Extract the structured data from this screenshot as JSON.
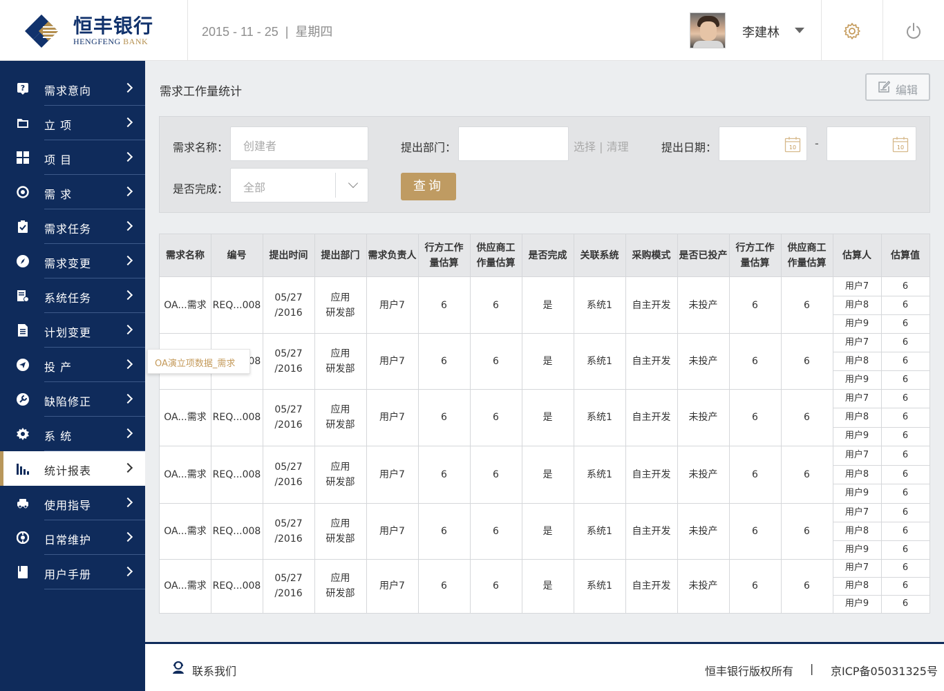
{
  "header": {
    "logo_cn": "恒丰银行",
    "logo_en_a": "HENGFENG",
    "logo_en_b": "BANK",
    "date_parts": [
      "2015 - 11 - 25",
      "|",
      "星期四"
    ],
    "user_name": "李建林"
  },
  "sidebar": {
    "items": [
      {
        "label": "需求意向",
        "icon": "question-icon"
      },
      {
        "label": "立  项",
        "icon": "folder-icon"
      },
      {
        "label": "项  目",
        "icon": "grid-icon"
      },
      {
        "label": "需  求",
        "icon": "target-icon"
      },
      {
        "label": "需求任务",
        "icon": "clipboard-check-icon"
      },
      {
        "label": "需求变更",
        "icon": "compass-icon"
      },
      {
        "label": "系统任务",
        "icon": "doc-edit-icon"
      },
      {
        "label": "计划变更",
        "icon": "document-icon"
      },
      {
        "label": "投  产",
        "icon": "send-icon"
      },
      {
        "label": "缺陷修正",
        "icon": "wrench-icon"
      },
      {
        "label": "系  统",
        "icon": "gear-icon"
      },
      {
        "label": "统计报表",
        "icon": "bar-chart-icon",
        "active": true
      },
      {
        "label": "使用指导",
        "icon": "car-icon"
      },
      {
        "label": "日常维护",
        "icon": "maintenance-icon"
      },
      {
        "label": "用户手册",
        "icon": "book-icon"
      }
    ]
  },
  "main": {
    "title": "需求工作量统计",
    "edit_label": "编辑"
  },
  "filter": {
    "name_label": "需求名称：",
    "name_placeholder": "创建者",
    "dept_label": "提出部门：",
    "dept_value": "",
    "dept_links": "选择 | 清理",
    "date_label": "提出日期：",
    "date_sep": "-",
    "done_label": "是否完成：",
    "done_value": "全部",
    "query_label": "查询",
    "calendar_day": "10"
  },
  "table": {
    "headers": [
      "需求名称",
      "编号",
      "提出时间",
      "提出部门",
      "需求负责人",
      "行方工作量估算",
      "供应商工作量估算",
      "是否完成",
      "关联系统",
      "采购模式",
      "是否已投产",
      "行方工作量估算",
      "供应商工作量估算",
      "估算人",
      "估算值"
    ],
    "header_lines": [
      [
        "需求名称"
      ],
      [
        "编号"
      ],
      [
        "提出时间"
      ],
      [
        "提出部门"
      ],
      [
        "需求负责人"
      ],
      [
        "行方工作",
        "量估算"
      ],
      [
        "供应商工",
        "作量估算"
      ],
      [
        "是否完成"
      ],
      [
        "关联系统"
      ],
      [
        "采购模式"
      ],
      [
        "是否已投产"
      ],
      [
        "行方工作",
        "量估算"
      ],
      [
        "供应商工",
        "作量估算"
      ],
      [
        "估算人"
      ],
      [
        "估算值"
      ]
    ],
    "rows": [
      {
        "name": "OA...需求",
        "code": "REQ...008",
        "date1": "05/27",
        "date2": "/2016",
        "dept1": "应用",
        "dept2": "研发部",
        "owner": "用户7",
        "bank_est": "6",
        "vendor_est": "6",
        "done": "是",
        "system": "系统1",
        "mode": "自主开发",
        "prod": "未投产",
        "bank_est2": "6",
        "vendor_est2": "6",
        "estimators": [
          {
            "user": "用户7",
            "value": "6"
          },
          {
            "user": "用户8",
            "value": "6"
          },
          {
            "user": "用户9",
            "value": "6"
          }
        ]
      },
      {
        "name": "OA...需求",
        "code": "REQ...008",
        "date1": "05/27",
        "date2": "/2016",
        "dept1": "应用",
        "dept2": "研发部",
        "owner": "用户7",
        "bank_est": "6",
        "vendor_est": "6",
        "done": "是",
        "system": "系统1",
        "mode": "自主开发",
        "prod": "未投产",
        "bank_est2": "6",
        "vendor_est2": "6",
        "estimators": [
          {
            "user": "用户7",
            "value": "6"
          },
          {
            "user": "用户8",
            "value": "6"
          },
          {
            "user": "用户9",
            "value": "6"
          }
        ]
      },
      {
        "name": "OA...需求",
        "code": "REQ...008",
        "date1": "05/27",
        "date2": "/2016",
        "dept1": "应用",
        "dept2": "研发部",
        "owner": "用户7",
        "bank_est": "6",
        "vendor_est": "6",
        "done": "是",
        "system": "系统1",
        "mode": "自主开发",
        "prod": "未投产",
        "bank_est2": "6",
        "vendor_est2": "6",
        "estimators": [
          {
            "user": "用户7",
            "value": "6"
          },
          {
            "user": "用户8",
            "value": "6"
          },
          {
            "user": "用户9",
            "value": "6"
          }
        ]
      },
      {
        "name": "OA...需求",
        "code": "REQ...008",
        "date1": "05/27",
        "date2": "/2016",
        "dept1": "应用",
        "dept2": "研发部",
        "owner": "用户7",
        "bank_est": "6",
        "vendor_est": "6",
        "done": "是",
        "system": "系统1",
        "mode": "自主开发",
        "prod": "未投产",
        "bank_est2": "6",
        "vendor_est2": "6",
        "estimators": [
          {
            "user": "用户7",
            "value": "6"
          },
          {
            "user": "用户8",
            "value": "6"
          },
          {
            "user": "用户9",
            "value": "6"
          }
        ]
      },
      {
        "name": "OA...需求",
        "code": "REQ...008",
        "date1": "05/27",
        "date2": "/2016",
        "dept1": "应用",
        "dept2": "研发部",
        "owner": "用户7",
        "bank_est": "6",
        "vendor_est": "6",
        "done": "是",
        "system": "系统1",
        "mode": "自主开发",
        "prod": "未投产",
        "bank_est2": "6",
        "vendor_est2": "6",
        "estimators": [
          {
            "user": "用户7",
            "value": "6"
          },
          {
            "user": "用户8",
            "value": "6"
          },
          {
            "user": "用户9",
            "value": "6"
          }
        ]
      },
      {
        "name": "OA...需求",
        "code": "REQ...008",
        "date1": "05/27",
        "date2": "/2016",
        "dept1": "应用",
        "dept2": "研发部",
        "owner": "用户7",
        "bank_est": "6",
        "vendor_est": "6",
        "done": "是",
        "system": "系统1",
        "mode": "自主开发",
        "prod": "未投产",
        "bank_est2": "6",
        "vendor_est2": "6",
        "estimators": [
          {
            "user": "用户7",
            "value": "6"
          },
          {
            "user": "用户8",
            "value": "6"
          },
          {
            "user": "用户9",
            "value": "6"
          }
        ]
      }
    ]
  },
  "tooltip": {
    "text": "OA演立项数据_需求"
  },
  "footer": {
    "contact": "联系我们",
    "copyright": "恒丰银行版权所有",
    "separator": "|",
    "icp": "京ICP备05031325号"
  },
  "colors": {
    "navy": "#0f2b5b",
    "gold": "#bf9b62",
    "active_bar": "#b9975b"
  }
}
